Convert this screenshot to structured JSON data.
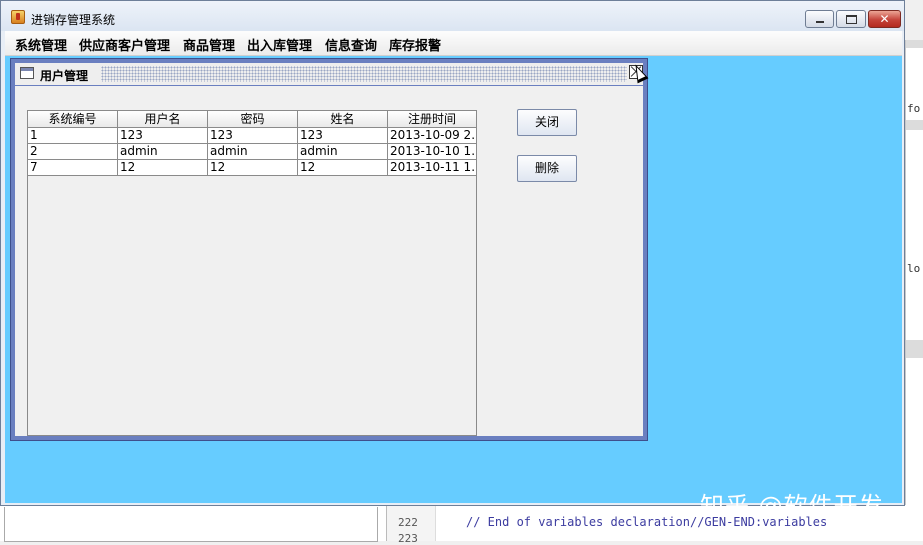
{
  "window": {
    "title": "进销存管理系统",
    "min_symbol": "",
    "max_symbol": "",
    "close_symbol": "✕"
  },
  "menubar": {
    "items": [
      "系统管理",
      "供应商客户管理",
      "商品管理",
      "出入库管理",
      "信息查询",
      "库存报警"
    ]
  },
  "internal_frame": {
    "title": "用户管理",
    "table": {
      "columns": [
        "系统编号",
        "用户名",
        "密码",
        "姓名",
        "注册时间"
      ],
      "rows": [
        [
          "1",
          "123",
          "123",
          "123",
          "2013-10-09 2..."
        ],
        [
          "2",
          "admin",
          "admin",
          "admin",
          "2013-10-10 1..."
        ],
        [
          "7",
          "12",
          "12",
          "12",
          "2013-10-11 1..."
        ]
      ]
    },
    "buttons": {
      "close_label": "关闭",
      "delete_label": "删除"
    }
  },
  "ide_background": {
    "line_numbers": [
      "222",
      "223"
    ],
    "code_line": "// End of variables declaration//GEN-END:variables",
    "right_fragment_1": "fo",
    "right_fragment_2": "lo"
  },
  "watermark": "知乎 @软件开发",
  "colors": {
    "desktop": "#66ccff",
    "frame_border": "#6a7fc0",
    "close_button": "#c5443b"
  }
}
